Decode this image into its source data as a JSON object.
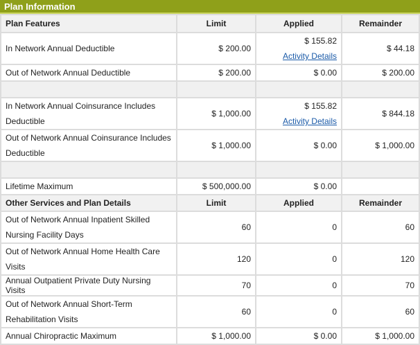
{
  "title": "Plan Information",
  "columns": {
    "feature": "Plan Features",
    "limit": "Limit",
    "applied": "Applied",
    "remainder": "Remainder"
  },
  "rows1": [
    {
      "feature": "In Network Annual Deductible",
      "limit": "$ 200.00",
      "applied": "$ 155.82",
      "link": "Activity Details",
      "remainder": "$ 44.18"
    },
    {
      "feature": "Out of Network Annual Deductible",
      "limit": "$ 200.00",
      "applied": "$ 0.00",
      "remainder": "$ 200.00"
    },
    {
      "feature": "In Network Annual Coinsurance Includes Deductible",
      "limit": "$ 1,000.00",
      "applied": "$ 155.82",
      "link": "Activity Details",
      "remainder": "$ 844.18"
    },
    {
      "feature": "Out of Network Annual Coinsurance Includes Deductible",
      "limit": "$ 1,000.00",
      "applied": "$ 0.00",
      "remainder": "$ 1,000.00"
    },
    {
      "feature": "Lifetime Maximum",
      "limit": "$ 500,000.00",
      "applied": "$ 0.00",
      "remainder": ""
    }
  ],
  "columns2": {
    "feature": "Other Services and Plan Details",
    "limit": "Limit",
    "applied": "Applied",
    "remainder": "Remainder"
  },
  "rows2": [
    {
      "feature": "Out of Network Annual Inpatient Skilled Nursing Facility Days",
      "limit": "60",
      "applied": "0",
      "remainder": "60"
    },
    {
      "feature": "Out of Network Annual Home Health Care Visits",
      "limit": "120",
      "applied": "0",
      "remainder": "120"
    },
    {
      "feature": "Annual Outpatient Private Duty Nursing Visits",
      "limit": "70",
      "applied": "0",
      "remainder": "70"
    },
    {
      "feature": "Out of Network Annual Short-Term Rehabilitation Visits",
      "limit": "60",
      "applied": "0",
      "remainder": "60"
    },
    {
      "feature": "Annual Chiropractic Maximum",
      "limit": "$ 1,000.00",
      "applied": "$ 0.00",
      "remainder": "$ 1,000.00"
    }
  ]
}
